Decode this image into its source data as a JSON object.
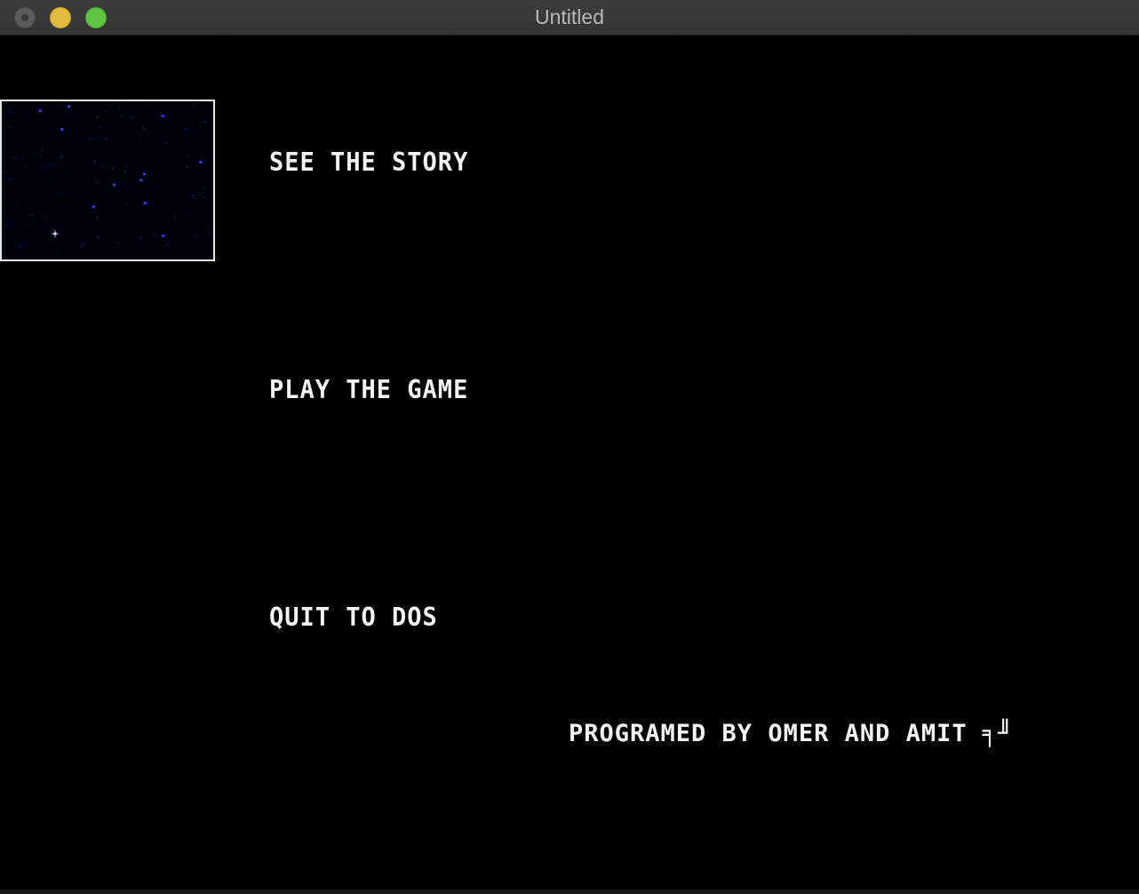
{
  "window": {
    "title": "Untitled"
  },
  "menu": {
    "items": [
      {
        "label": "SEE THE STORY"
      },
      {
        "label": "PLAY THE GAME"
      },
      {
        "label": "QUIT TO DOS"
      }
    ]
  },
  "credits": {
    "text": "PROGRAMED BY OMER AND AMIT ╕╜"
  },
  "colors": {
    "background": "#000000",
    "text": "#f4f4f4",
    "star": "#3a3aff",
    "border": "#e6e6e6"
  },
  "icons": {
    "close": "close-button-icon",
    "minimize": "minimize-button-icon",
    "zoom": "zoom-button-icon",
    "starfield": "starfield-icon"
  }
}
